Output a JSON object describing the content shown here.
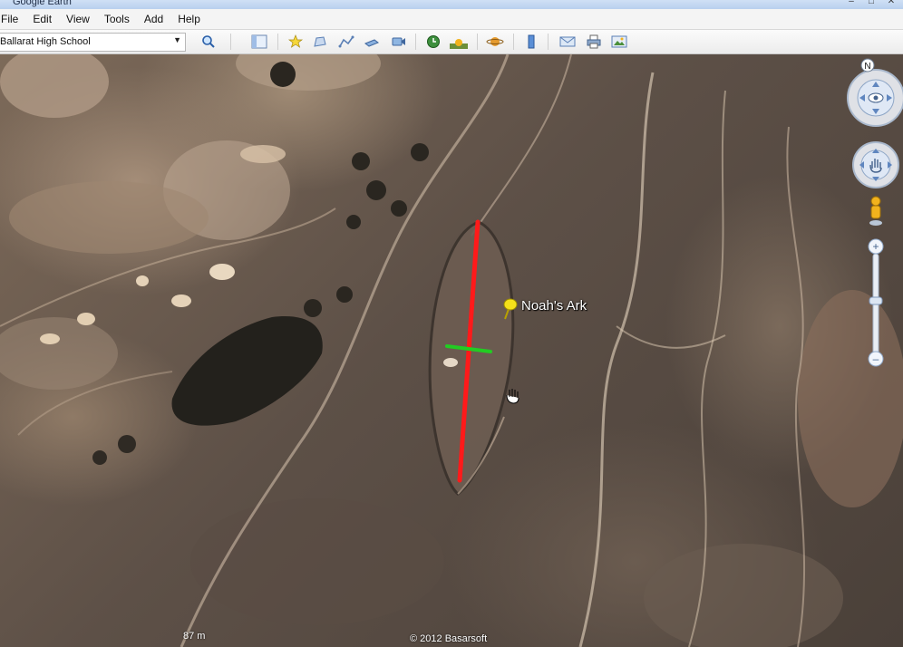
{
  "window": {
    "title": "Google Earth"
  },
  "menu": [
    "File",
    "Edit",
    "View",
    "Tools",
    "Add",
    "Help"
  ],
  "search": {
    "value": "Ballarat High School"
  },
  "toolbar": {
    "icons": [
      "search-icon",
      "sidebar-toggle-icon",
      "placemark-icon",
      "polygon-icon",
      "path-icon",
      "image-overlay-icon",
      "record-tour-icon",
      "historical-imagery-icon",
      "sunlight-icon",
      "planets-icon",
      "ruler-icon",
      "email-icon",
      "print-icon",
      "save-image-icon"
    ]
  },
  "map": {
    "placemark_label": "Noah's Ark",
    "scale": "87 m",
    "copyright": "© 2012 Basarsoft",
    "compass_north": "N",
    "colors": {
      "measure_line": "#ff1a1a",
      "cross_line": "#22cc22",
      "pin": "#f5e11a"
    }
  }
}
